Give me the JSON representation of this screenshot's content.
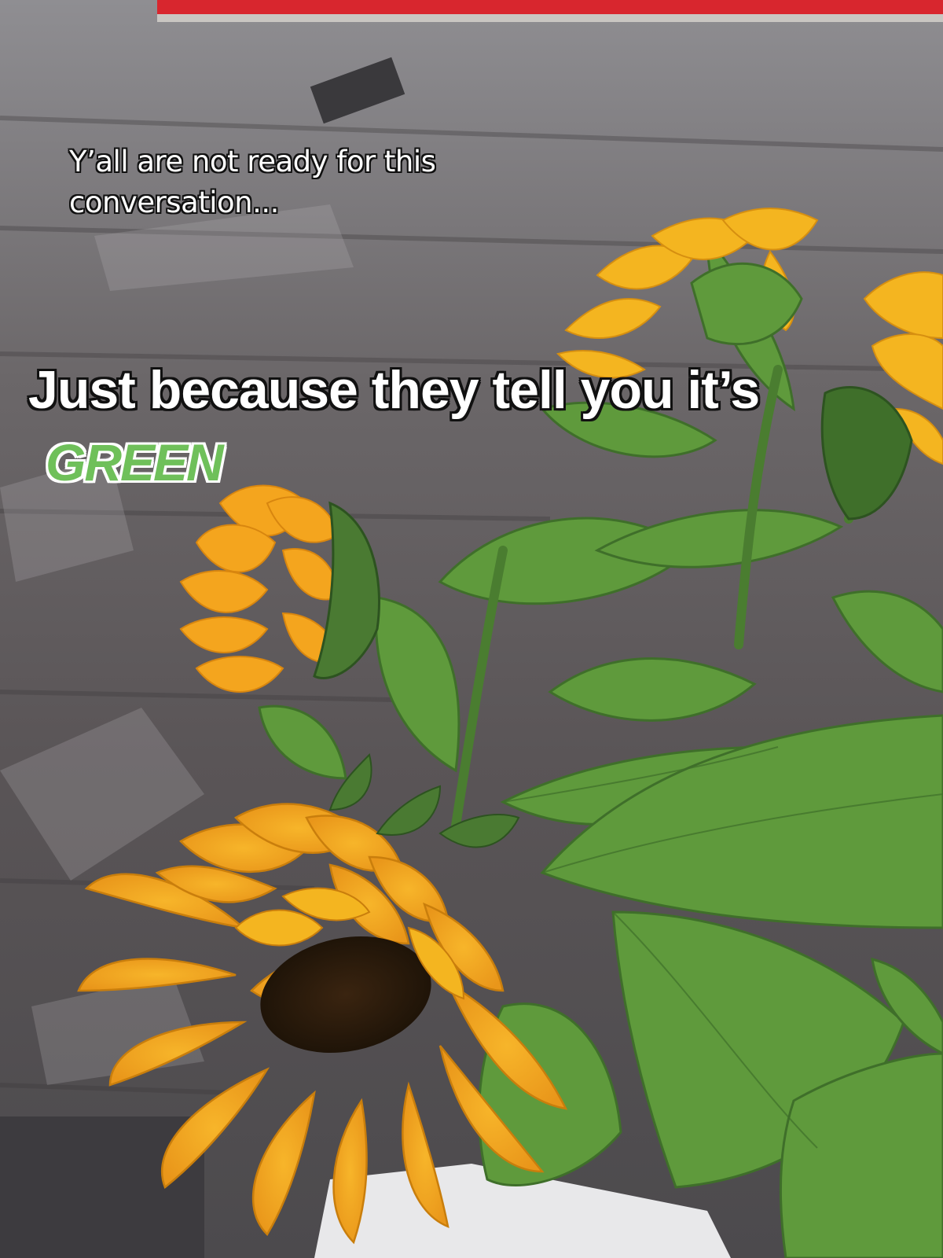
{
  "photo": {
    "subject": "sunflower-bouquet",
    "colors": {
      "petal": "#f2a81d",
      "petal_light": "#f7c637",
      "leaf": "#5f9a3c",
      "leaf_dark": "#3f6f2a",
      "pavement": "#6d6a6d",
      "accent_red": "#d8262e"
    }
  },
  "captions": {
    "top_line": "Y’all are not ready for this conversation...",
    "headline": "Just because they tell you it’s",
    "highlight_word": "GREEN",
    "highlight_color": "#6fc05a"
  }
}
